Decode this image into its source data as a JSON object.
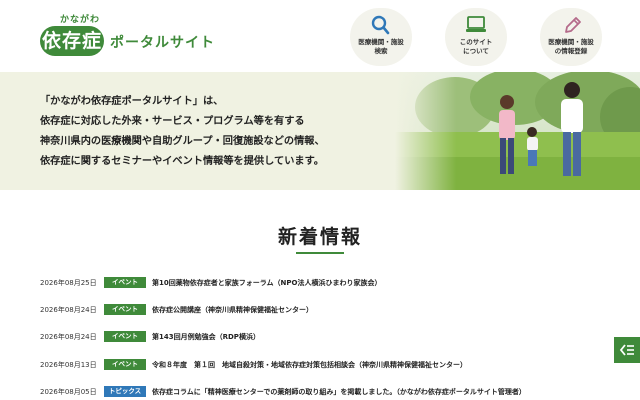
{
  "header": {
    "logo_small": "かながわ",
    "logo_main": "依存症",
    "logo_sub": "ポータルサイト",
    "nav": [
      {
        "line1": "医療機関・施設",
        "line2": "検索",
        "icon": "search-icon"
      },
      {
        "line1": "このサイト",
        "line2": "について",
        "icon": "monitor-icon"
      },
      {
        "line1": "医療機関・施設",
        "line2": "の情報登録",
        "icon": "pencil-icon"
      }
    ]
  },
  "hero": {
    "lines": [
      "「かながわ依存症ポータルサイト」は、",
      "依存症に対応した外来・サービス・プログラム等を有する",
      "神奈川県内の医療機関や自助グループ・回復施設などの情報、",
      "依存症に関するセミナーやイベント情報等を提供しています。"
    ]
  },
  "news": {
    "title": "新着情報",
    "items": [
      {
        "date": "2026年08月25日",
        "tag": "イベント",
        "tag_type": "event",
        "text": "第10回薬物依存症者と家族フォーラム（NPO法人横浜ひまわり家族会）"
      },
      {
        "date": "2026年08月24日",
        "tag": "イベント",
        "tag_type": "event",
        "text": "依存症公開講座（神奈川県精神保健福祉センター）"
      },
      {
        "date": "2026年08月24日",
        "tag": "イベント",
        "tag_type": "event",
        "text": "第143回月例勉強会（RDP横浜）"
      },
      {
        "date": "2026年08月13日",
        "tag": "イベント",
        "tag_type": "event",
        "text": "令和８年度　第１回　地域自殺対策・地域依存症対策包括相談会（神奈川県精神保健福祉センター）"
      },
      {
        "date": "2026年08月05日",
        "tag": "トピックス",
        "tag_type": "topic",
        "text": "依存症コラムに「精神医療センターでの薬剤師の取り組み」を掲載しました。（かながわ依存症ポータルサイト管理者）"
      }
    ]
  },
  "colors": {
    "brand_green": "#3f8a3a",
    "topic_blue": "#2f78b8",
    "hero_bg": "#f0f2e2"
  }
}
